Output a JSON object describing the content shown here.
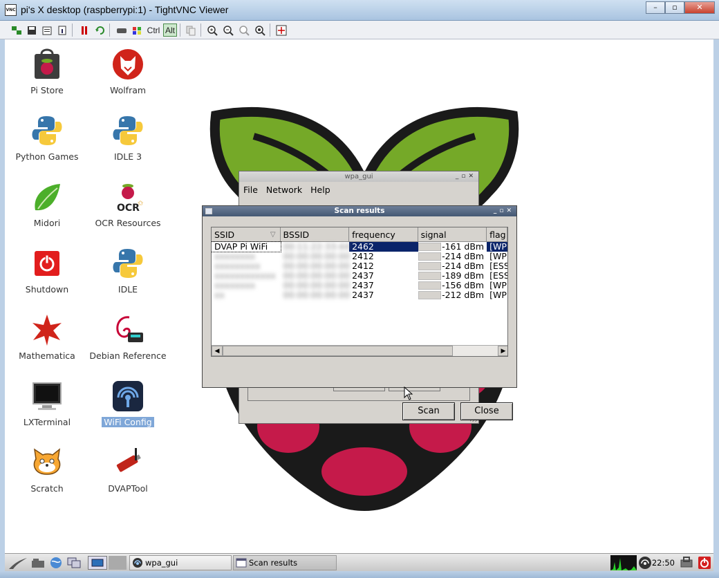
{
  "vnc_window": {
    "title": "pi's X desktop (raspberrypi:1) - TightVNC Viewer",
    "logo_text": "VNC",
    "toolbar": {
      "ctrl_label": "Ctrl",
      "alt_label": "Alt"
    }
  },
  "desktop": {
    "icons": [
      {
        "label": "Pi Store"
      },
      {
        "label": "Wolfram"
      },
      {
        "label": "Python Games"
      },
      {
        "label": "IDLE 3"
      },
      {
        "label": "Midori"
      },
      {
        "label": "OCR Resources"
      },
      {
        "label": "Shutdown"
      },
      {
        "label": "IDLE"
      },
      {
        "label": "Mathematica"
      },
      {
        "label": "Debian Reference"
      },
      {
        "label": "LXTerminal"
      },
      {
        "label": "WiFi Config"
      },
      {
        "label": "Scratch"
      },
      {
        "label": "DVAPTool"
      }
    ],
    "ocr_text": "OCR"
  },
  "wpa_gui": {
    "title": "wpa_gui",
    "menu": [
      "File",
      "Network",
      "Help"
    ]
  },
  "scan_results": {
    "title": "Scan results",
    "columns": [
      "SSID",
      "BSSID",
      "frequency",
      "signal",
      "flag"
    ],
    "rows": [
      {
        "ssid": "DVAP Pi WiFi",
        "bssid": "00:11:22:33:44:55",
        "frequency": "2462",
        "signal": "-161 dBm",
        "flags": "[WP",
        "obscured": false
      },
      {
        "ssid": "xxxxxxxx",
        "bssid": "00:00:00:00:00:00",
        "frequency": "2412",
        "signal": "-214 dBm",
        "flags": "[WP",
        "obscured": true
      },
      {
        "ssid": "xxxxxxxxx",
        "bssid": "00:00:00:00:00:00",
        "frequency": "2412",
        "signal": "-214 dBm",
        "flags": "[ESS",
        "obscured": true
      },
      {
        "ssid": "xxxxxxxxxxxx",
        "bssid": "00:00:00:00:00:00",
        "frequency": "2437",
        "signal": "-189 dBm",
        "flags": "[ESS",
        "obscured": true
      },
      {
        "ssid": "xxxxxxxx",
        "bssid": "00:00:00:00:00:00",
        "frequency": "2437",
        "signal": "-156 dBm",
        "flags": "[WP",
        "obscured": true
      },
      {
        "ssid": "xx",
        "bssid": "00:00:00:00:00:00",
        "frequency": "2437",
        "signal": "-212 dBm",
        "flags": "[WP",
        "obscured": true
      }
    ],
    "scan_button": "Scan",
    "close_button": "Close"
  },
  "taskbar": {
    "tasks": [
      {
        "label": "wpa_gui"
      },
      {
        "label": "Scan results"
      }
    ],
    "clock": "22:50"
  },
  "colors": {
    "selection": "#0a246a",
    "raspberry": "#c51a4a",
    "leaf": "#75a928"
  }
}
